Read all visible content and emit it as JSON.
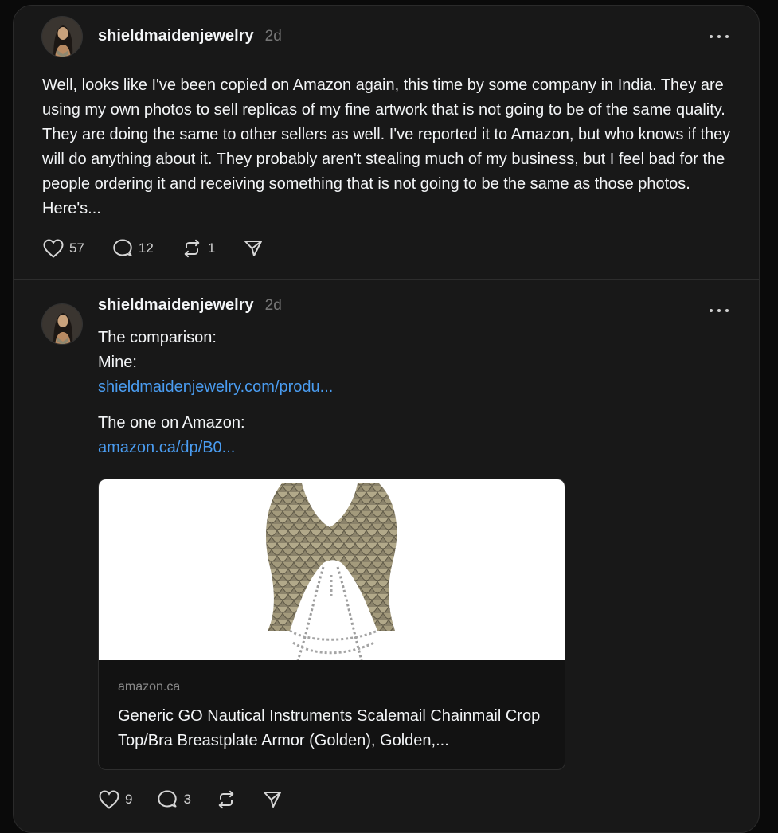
{
  "posts": [
    {
      "username": "shieldmaidenjewelry",
      "time": "2d",
      "text": "Well, looks like I've been copied on Amazon again, this time by some company in India. They are using my own photos to sell replicas of my fine artwork that is not going to be of the same quality. They are doing the same to other sellers as well. I've reported it to Amazon, but who knows if they will do anything about it. They probably aren't stealing much of my business, but I feel bad for the people ordering it and receiving something that is not going to be the same as those photos. Here's...",
      "likes": "57",
      "comments": "12",
      "reposts": "1"
    },
    {
      "username": "shieldmaidenjewelry",
      "time": "2d",
      "lines": {
        "comparison": "The comparison:",
        "mine": "Mine:",
        "mine_link": "shieldmaidenjewelry.com/produ...",
        "amazon_label": "The one on Amazon:",
        "amazon_link": "amazon.ca/dp/B0..."
      },
      "preview": {
        "domain": "amazon.ca",
        "title": "Generic GO Nautical Instruments Scalemail Chainmail Crop Top/Bra Breastplate Armor (Golden), Golden,..."
      },
      "likes": "9",
      "comments": "3"
    }
  ],
  "icons": {
    "like": "heart-icon",
    "comment": "comment-icon",
    "repost": "repost-icon",
    "share": "send-icon",
    "more": "more-icon"
  },
  "colors": {
    "background": "#0a0a0a",
    "card": "#181818",
    "text": "#f3f5f7",
    "muted": "#777777",
    "link": "#4a9cf0"
  }
}
